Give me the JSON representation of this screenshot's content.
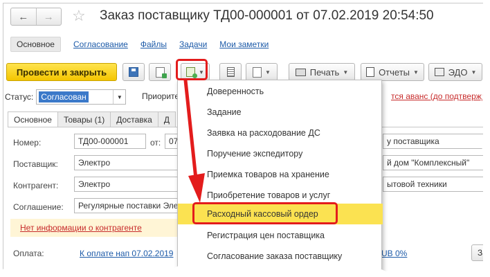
{
  "window": {
    "title": "Заказ поставщику ТД00-000001 от 07.02.2019 20:54:50",
    "nav_back": "←",
    "nav_forward": "→",
    "star": "☆"
  },
  "links": {
    "main": "Основное",
    "items": [
      "Согласование",
      "Файлы",
      "Задачи",
      "Мои заметки"
    ]
  },
  "toolbar": {
    "post_close": "Провести и закрыть",
    "print": "Печать",
    "reports": "Отчеты",
    "edo": "ЭДО"
  },
  "status": {
    "label": "Статус:",
    "value": "Согласован",
    "priority_label": "Приорите",
    "avans_text": "тся аванс (до подтвержд"
  },
  "tabs": [
    "Основное",
    "Товары (1)",
    "Доставка",
    "Д"
  ],
  "form": {
    "number_label": "Номер:",
    "number_value": "ТД00-000001",
    "from_label": "от:",
    "from_value": "07",
    "supplier_label": "Поставщик:",
    "supplier_value": "Электро",
    "counterparty_label": "Контрагент:",
    "counterparty_value": "Электро",
    "agreement_label": "Соглашение:",
    "agreement_value": "Регулярные поставки Эле",
    "right_1": "у поставщика",
    "right_2": "й дом \"Комплексный\"",
    "right_3": "ытовой техники",
    "warning": "Нет информации о контрагенте",
    "payment_label": "Оплата:",
    "payment_link": "К оплате нап 07.02.2019",
    "rub": "UB 0%",
    "za_button": "За"
  },
  "menu": {
    "items": [
      "Доверенность",
      "Задание",
      "Заявка на расходование ДС",
      "Поручение экспедитору",
      "Приемка товаров на хранение",
      "Приобретение товаров и услуг",
      "Расходный кассовый ордер",
      "Регистрация цен поставщика",
      "Согласование заказа поставщику"
    ],
    "selected_index": 6
  },
  "colors": {
    "accent_yellow": "#f4c500",
    "highlight": "#e31c1c",
    "link": "#1c5aa8",
    "selected_item": "#fbe251"
  }
}
